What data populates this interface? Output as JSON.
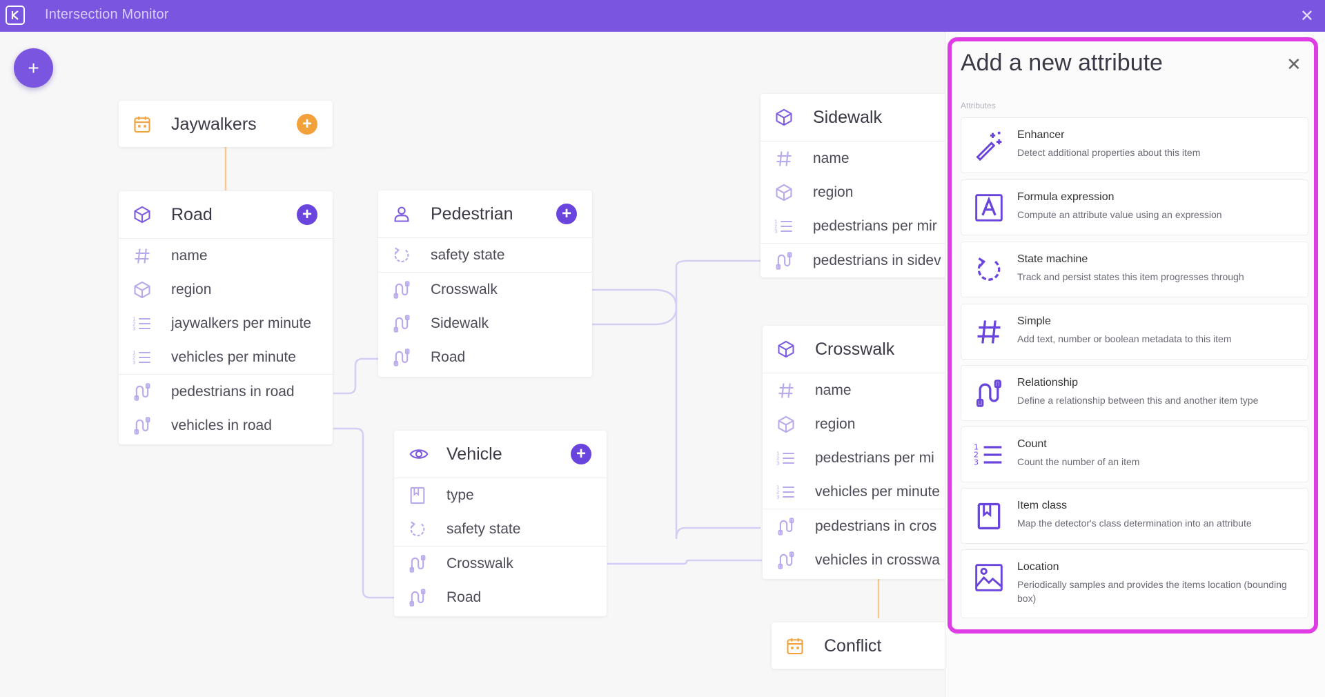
{
  "app": {
    "title": "Intersection Monitor"
  },
  "colors": {
    "accent": "#7a55e0",
    "icon_purple": "#7d5ce0",
    "event_orange": "#f3a13a",
    "highlight_magenta": "#e03ce6"
  },
  "canvas": {
    "add_button": "+",
    "cards": {
      "jaywalkers": {
        "title": "Jaywalkers",
        "icon": "calendar-icon"
      },
      "road": {
        "title": "Road",
        "icon": "cube-icon",
        "rows": [
          "name",
          "region",
          "jaywalkers per minute",
          "vehicles per minute",
          "pedestrians in road",
          "vehicles in road"
        ]
      },
      "pedestrian": {
        "title": "Pedestrian",
        "icon": "person-icon",
        "rows": [
          "safety state",
          "Crosswalk",
          "Sidewalk",
          "Road"
        ]
      },
      "vehicle": {
        "title": "Vehicle",
        "icon": "eye-icon",
        "rows": [
          "type",
          "safety state",
          "Crosswalk",
          "Road"
        ]
      },
      "sidewalk": {
        "title": "Sidewalk",
        "icon": "cube-icon",
        "rows": [
          "name",
          "region",
          "pedestrians per mir",
          "pedestrians in sidev"
        ]
      },
      "crosswalk": {
        "title": "Crosswalk",
        "icon": "cube-icon",
        "rows": [
          "name",
          "region",
          "pedestrians per mi",
          "vehicles per minute",
          "pedestrians in cros",
          "vehicles in crosswa"
        ]
      },
      "conflict": {
        "title": "Conflict",
        "icon": "calendar-icon"
      }
    }
  },
  "panel": {
    "title": "Add a new attribute",
    "section_label": "Attributes",
    "options": [
      {
        "name": "Enhancer",
        "description": "Detect additional properties about this item",
        "icon": "magic-wand-icon"
      },
      {
        "name": "Formula expression",
        "description": "Compute an attribute value using an expression",
        "icon": "formula-icon"
      },
      {
        "name": "State machine",
        "description": "Track and persist states this item progresses through",
        "icon": "state-cycle-icon"
      },
      {
        "name": "Simple",
        "description": "Add text, number or boolean metadata to this item",
        "icon": "hash-icon"
      },
      {
        "name": "Relationship",
        "description": "Define a relationship between this and another item type",
        "icon": "relationship-icon"
      },
      {
        "name": "Count",
        "description": "Count the number of an item",
        "icon": "count-list-icon"
      },
      {
        "name": "Item class",
        "description": "Map the detector's class determination into an attribute",
        "icon": "bookmark-icon"
      },
      {
        "name": "Location",
        "description": "Periodically samples and provides the items location (bounding box)",
        "icon": "location-image-icon"
      }
    ]
  }
}
